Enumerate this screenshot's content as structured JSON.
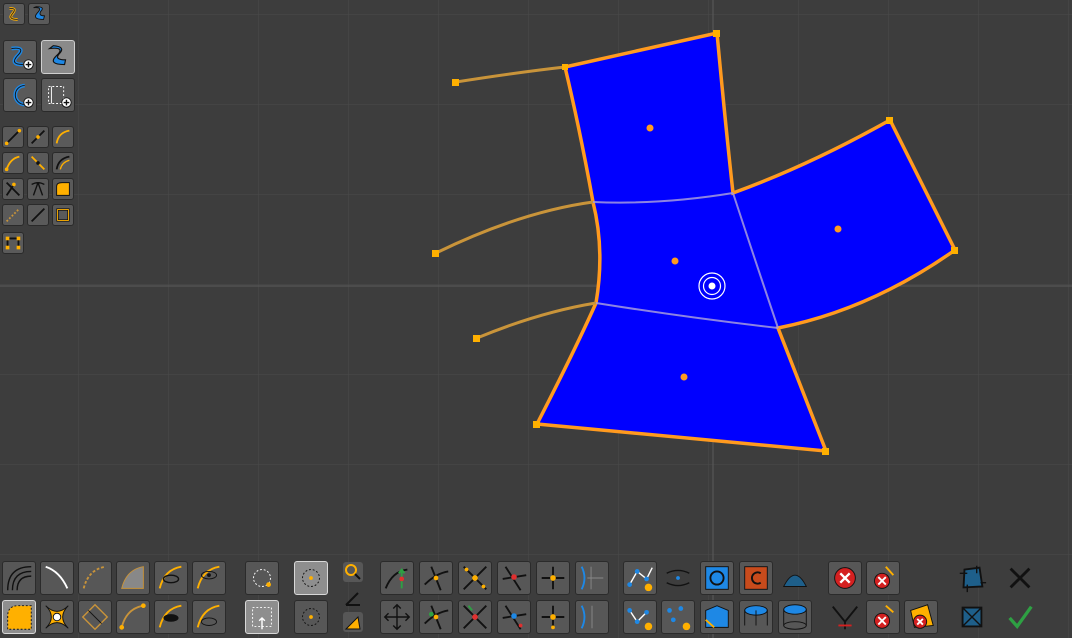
{
  "viewport": {
    "grid_color": "#4a4a4a",
    "background": "#3d3d3d",
    "face_fill": "#0000ff",
    "edge_color": "#ff9a1f",
    "curve_color": "#c9943a",
    "handle_color": "#ffb000"
  },
  "top_bar": {
    "icons": [
      "curve-mode-icon",
      "surface-mode-icon"
    ]
  },
  "left_toolbar": {
    "groups": [
      [
        "new-curve-tool",
        "new-surface-tool"
      ],
      [
        "circle-curve-tool",
        "rectangle-curve-tool"
      ],
      [
        "line-tool",
        "line-dot-tool",
        "arc-tool"
      ],
      [
        "arc-end-tool",
        "segment-tool",
        "bend-tool"
      ],
      [
        "split-tool",
        "join-tool",
        "fill-corner-tool"
      ],
      [
        "dashed-line-tool",
        "straight-line-tool",
        "frame-tool"
      ],
      [
        "group-tool"
      ]
    ]
  },
  "bottom_toolbar": {
    "groups": [
      "curve-tools",
      "selection-tools",
      "angle-tools",
      "transform-tools",
      "mesh-tools",
      "delete-tools",
      "confirm-tools"
    ],
    "accent_confirm": "#2ea043",
    "accent_delete": "#d42020"
  }
}
